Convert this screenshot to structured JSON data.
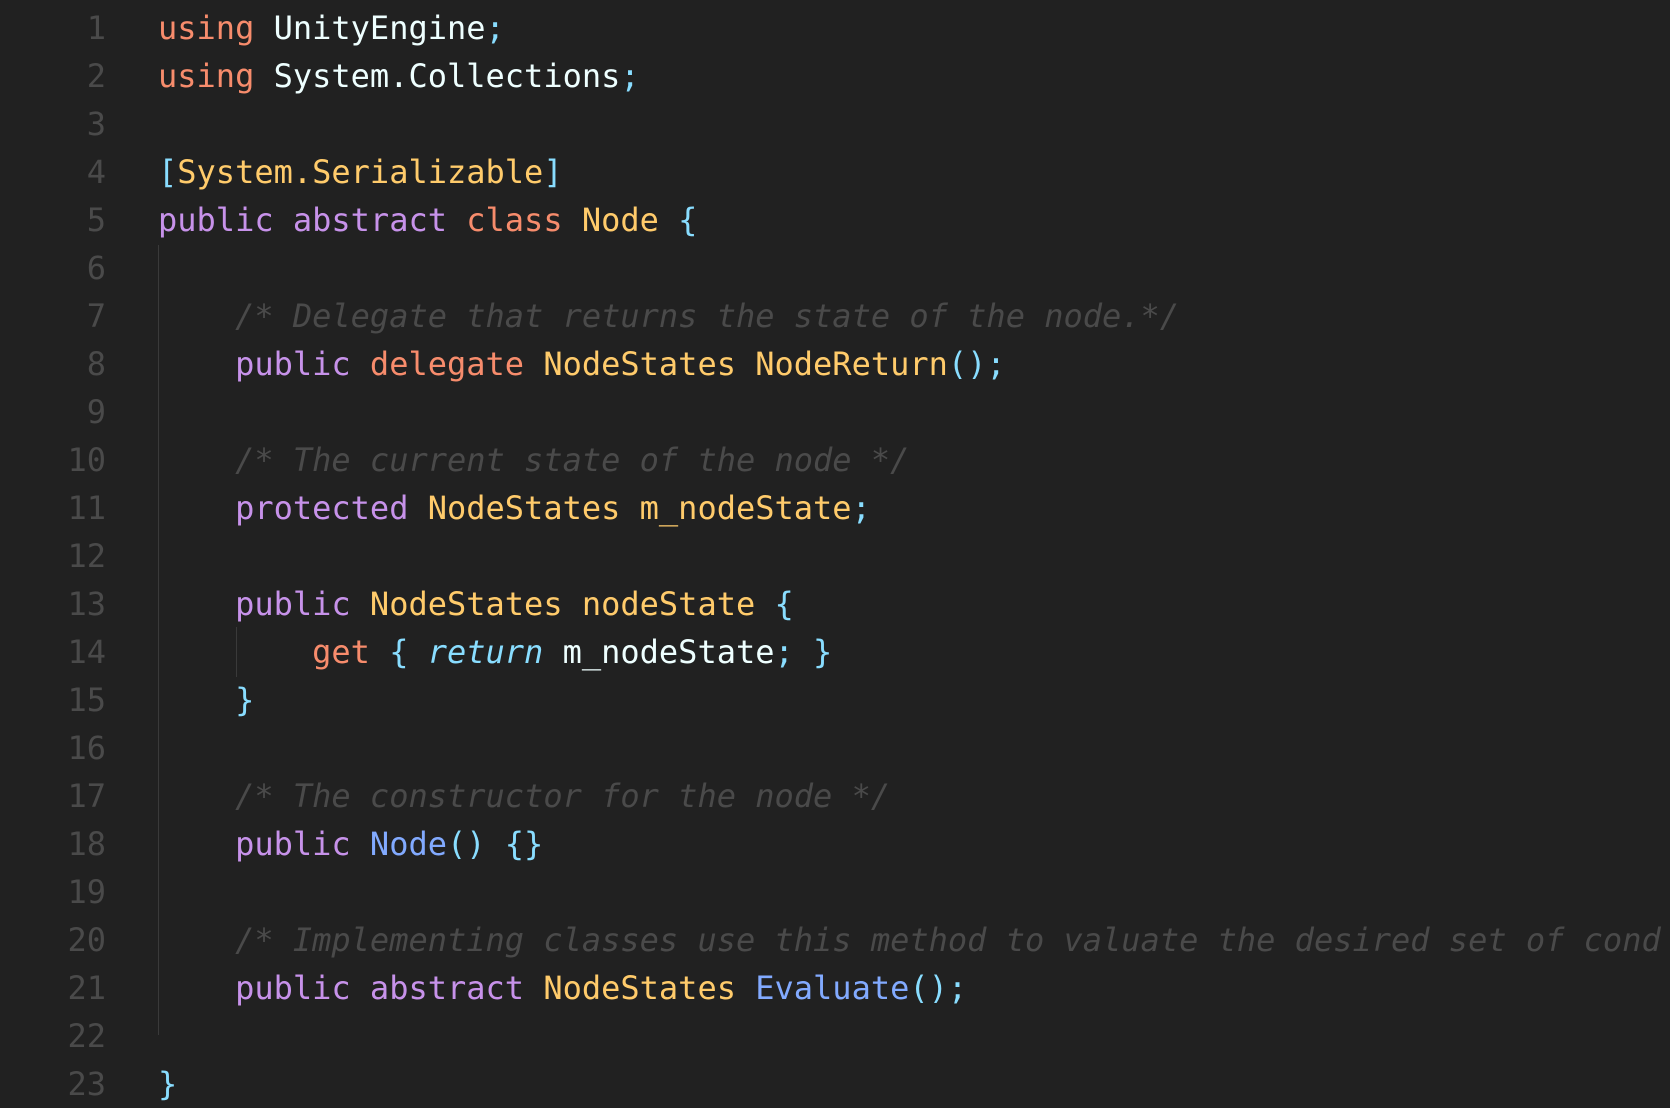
{
  "editor": {
    "language": "C#",
    "lines": [
      {
        "n": "1",
        "tokens": [
          {
            "t": "using",
            "c": "kw-using"
          },
          {
            "t": " ",
            "c": "plain"
          },
          {
            "t": "UnityEngine",
            "c": "plain"
          },
          {
            "t": ";",
            "c": "punct"
          }
        ]
      },
      {
        "n": "2",
        "tokens": [
          {
            "t": "using",
            "c": "kw-using"
          },
          {
            "t": " ",
            "c": "plain"
          },
          {
            "t": "System.Collections",
            "c": "plain"
          },
          {
            "t": ";",
            "c": "punct"
          }
        ]
      },
      {
        "n": "3",
        "tokens": []
      },
      {
        "n": "4",
        "tokens": [
          {
            "t": "[",
            "c": "punct"
          },
          {
            "t": "System.Serializable",
            "c": "type"
          },
          {
            "t": "]",
            "c": "punct"
          }
        ]
      },
      {
        "n": "5",
        "tokens": [
          {
            "t": "public",
            "c": "kw-mod"
          },
          {
            "t": " ",
            "c": "plain"
          },
          {
            "t": "abstract",
            "c": "kw-mod"
          },
          {
            "t": " ",
            "c": "plain"
          },
          {
            "t": "class",
            "c": "kw-class"
          },
          {
            "t": " ",
            "c": "plain"
          },
          {
            "t": "Node",
            "c": "type"
          },
          {
            "t": " ",
            "c": "plain"
          },
          {
            "t": "{",
            "c": "punct"
          }
        ]
      },
      {
        "n": "6",
        "tokens": []
      },
      {
        "n": "7",
        "tokens": [
          {
            "t": "    ",
            "c": "plain"
          },
          {
            "t": "/* Delegate that returns the state of the node.*/",
            "c": "comment"
          }
        ]
      },
      {
        "n": "8",
        "tokens": [
          {
            "t": "    ",
            "c": "plain"
          },
          {
            "t": "public",
            "c": "kw-mod"
          },
          {
            "t": " ",
            "c": "plain"
          },
          {
            "t": "delegate",
            "c": "kw-delegate"
          },
          {
            "t": " ",
            "c": "plain"
          },
          {
            "t": "NodeStates",
            "c": "type"
          },
          {
            "t": " ",
            "c": "plain"
          },
          {
            "t": "NodeReturn",
            "c": "type"
          },
          {
            "t": "();",
            "c": "punct"
          }
        ]
      },
      {
        "n": "9",
        "tokens": []
      },
      {
        "n": "10",
        "tokens": [
          {
            "t": "    ",
            "c": "plain"
          },
          {
            "t": "/* The current state of the node */",
            "c": "comment"
          }
        ]
      },
      {
        "n": "11",
        "tokens": [
          {
            "t": "    ",
            "c": "plain"
          },
          {
            "t": "protected",
            "c": "kw-mod"
          },
          {
            "t": " ",
            "c": "plain"
          },
          {
            "t": "NodeStates",
            "c": "type"
          },
          {
            "t": " ",
            "c": "plain"
          },
          {
            "t": "m_nodeState",
            "c": "type"
          },
          {
            "t": ";",
            "c": "punct"
          }
        ]
      },
      {
        "n": "12",
        "tokens": []
      },
      {
        "n": "13",
        "tokens": [
          {
            "t": "    ",
            "c": "plain"
          },
          {
            "t": "public",
            "c": "kw-mod"
          },
          {
            "t": " ",
            "c": "plain"
          },
          {
            "t": "NodeStates",
            "c": "type"
          },
          {
            "t": " ",
            "c": "plain"
          },
          {
            "t": "nodeState",
            "c": "type"
          },
          {
            "t": " ",
            "c": "plain"
          },
          {
            "t": "{",
            "c": "punct"
          }
        ]
      },
      {
        "n": "14",
        "tokens": [
          {
            "t": "        ",
            "c": "plain"
          },
          {
            "t": "get",
            "c": "kw-get"
          },
          {
            "t": " ",
            "c": "plain"
          },
          {
            "t": "{",
            "c": "punct"
          },
          {
            "t": " ",
            "c": "plain"
          },
          {
            "t": "return",
            "c": "ret"
          },
          {
            "t": " ",
            "c": "plain"
          },
          {
            "t": "m_nodeState",
            "c": "plain"
          },
          {
            "t": ";",
            "c": "punct"
          },
          {
            "t": " ",
            "c": "plain"
          },
          {
            "t": "}",
            "c": "punct"
          }
        ]
      },
      {
        "n": "15",
        "tokens": [
          {
            "t": "    ",
            "c": "plain"
          },
          {
            "t": "}",
            "c": "punct"
          }
        ]
      },
      {
        "n": "16",
        "tokens": []
      },
      {
        "n": "17",
        "tokens": [
          {
            "t": "    ",
            "c": "plain"
          },
          {
            "t": "/* The constructor for the node */",
            "c": "comment"
          }
        ]
      },
      {
        "n": "18",
        "tokens": [
          {
            "t": "    ",
            "c": "plain"
          },
          {
            "t": "public",
            "c": "kw-mod"
          },
          {
            "t": " ",
            "c": "plain"
          },
          {
            "t": "Node",
            "c": "fn"
          },
          {
            "t": "()",
            "c": "punct"
          },
          {
            "t": " ",
            "c": "plain"
          },
          {
            "t": "{}",
            "c": "punct"
          }
        ]
      },
      {
        "n": "19",
        "tokens": []
      },
      {
        "n": "20",
        "tokens": [
          {
            "t": "    ",
            "c": "plain"
          },
          {
            "t": "/* Implementing classes use this method to valuate the desired set of cond",
            "c": "comment"
          }
        ]
      },
      {
        "n": "21",
        "tokens": [
          {
            "t": "    ",
            "c": "plain"
          },
          {
            "t": "public",
            "c": "kw-mod"
          },
          {
            "t": " ",
            "c": "plain"
          },
          {
            "t": "abstract",
            "c": "kw-mod"
          },
          {
            "t": " ",
            "c": "plain"
          },
          {
            "t": "NodeStates",
            "c": "type"
          },
          {
            "t": " ",
            "c": "plain"
          },
          {
            "t": "Evaluate",
            "c": "fn"
          },
          {
            "t": "();",
            "c": "punct"
          }
        ]
      },
      {
        "n": "22",
        "tokens": []
      },
      {
        "n": "23",
        "tokens": [
          {
            "t": "}",
            "c": "punct"
          }
        ]
      }
    ]
  }
}
